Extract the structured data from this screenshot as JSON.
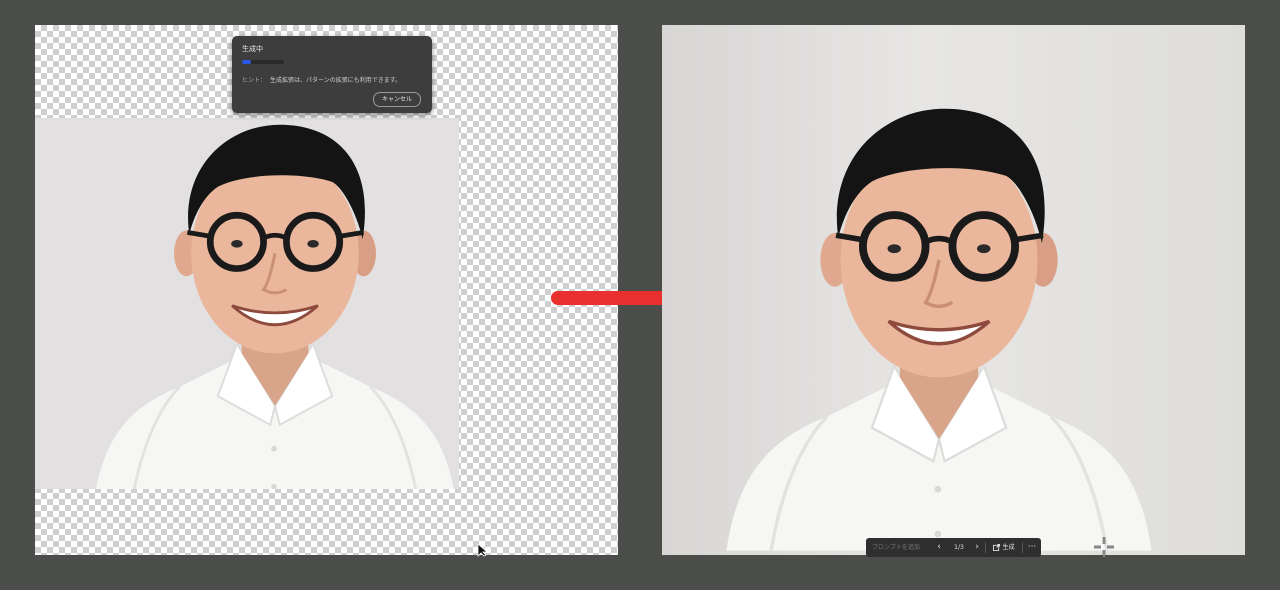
{
  "generating_dialog": {
    "title": "生成中",
    "progress": 0.22,
    "hint_label": "ヒント：",
    "hint_text": "生成拡張は、パターンの拡張にも利用できます。",
    "cancel_label": "キャンセル"
  },
  "taskbar": {
    "prompt_placeholder": "プロンプトを追加",
    "variant_counter": "1/3",
    "generate_label": "生成",
    "more_label": "···"
  },
  "colors": {
    "accent_blue": "#2b57e6",
    "arrow_red": "#e8302f",
    "app_background": "#4b4d4a"
  },
  "icons": {
    "prev": "chevron-left-icon",
    "next": "chevron-right-icon",
    "generate": "generate-icon",
    "arrow": "right-arrow-icon",
    "cursor": "crosshair-cursor-icon",
    "pointer": "arrow-pointer-icon"
  }
}
